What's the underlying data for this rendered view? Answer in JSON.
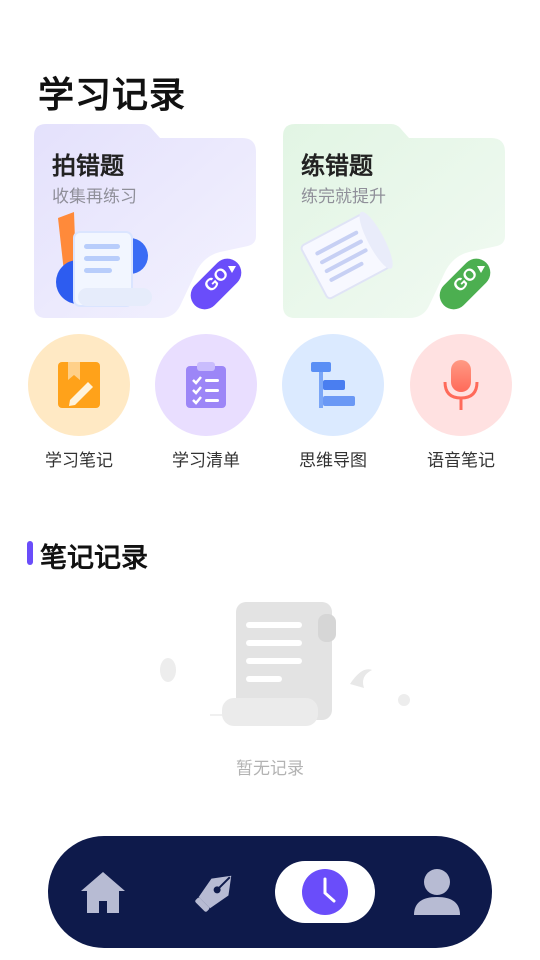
{
  "header": {
    "title": "学习记录"
  },
  "cards": [
    {
      "title": "拍错题",
      "subtitle": "收集再练习",
      "badge": "GO"
    },
    {
      "title": "练错题",
      "subtitle": "练完就提升",
      "badge": "GO"
    }
  ],
  "quick_actions": [
    {
      "label": "学习笔记",
      "icon": "notebook-pen-icon",
      "color": "#ffe9c4"
    },
    {
      "label": "学习清单",
      "icon": "checklist-clipboard-icon",
      "color": "#e9deff"
    },
    {
      "label": "思维导图",
      "icon": "mind-map-icon",
      "color": "#dbeaff"
    },
    {
      "label": "语音笔记",
      "icon": "microphone-icon",
      "color": "#ffe1e1"
    }
  ],
  "notes_section": {
    "title": "笔记记录",
    "empty_text": "暂无记录"
  },
  "tabbar": {
    "items": [
      {
        "icon": "home-icon",
        "active": false
      },
      {
        "icon": "pen-nib-icon",
        "active": false
      },
      {
        "icon": "clock-icon",
        "active": true
      },
      {
        "icon": "user-icon",
        "active": false
      }
    ],
    "active_color": "#6a4dfa",
    "background": "#0e1a4b"
  }
}
